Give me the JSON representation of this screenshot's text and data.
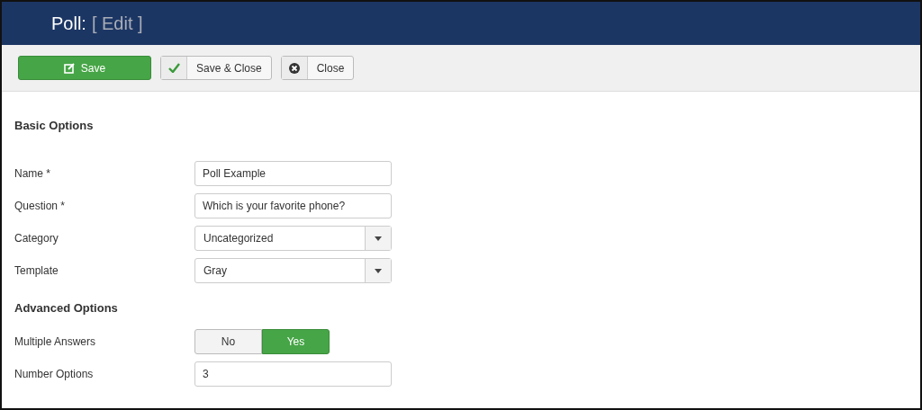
{
  "header": {
    "title": "Poll:",
    "subtitle": "[ Edit ]"
  },
  "toolbar": [
    {
      "kind": "save",
      "label": "Save"
    },
    {
      "kind": "save-close",
      "label": "Save & Close"
    },
    {
      "kind": "close",
      "label": "Close"
    }
  ],
  "sections": [
    {
      "title": "Basic Options",
      "fields": [
        {
          "kind": "text",
          "label": "Name *",
          "value": "Poll Example"
        },
        {
          "kind": "text",
          "label": "Question *",
          "value": "Which is your favorite phone?"
        },
        {
          "kind": "select",
          "label": "Category",
          "value": "Uncategorized"
        },
        {
          "kind": "select",
          "label": "Template",
          "value": "Gray"
        }
      ]
    },
    {
      "title": "Advanced Options",
      "fields": [
        {
          "kind": "toggle",
          "label": "Multiple Answers",
          "options": [
            {
              "label": "No",
              "selected": false
            },
            {
              "label": "Yes",
              "selected": true
            }
          ]
        },
        {
          "kind": "text",
          "label": "Number Options",
          "value": "3"
        }
      ]
    }
  ]
}
